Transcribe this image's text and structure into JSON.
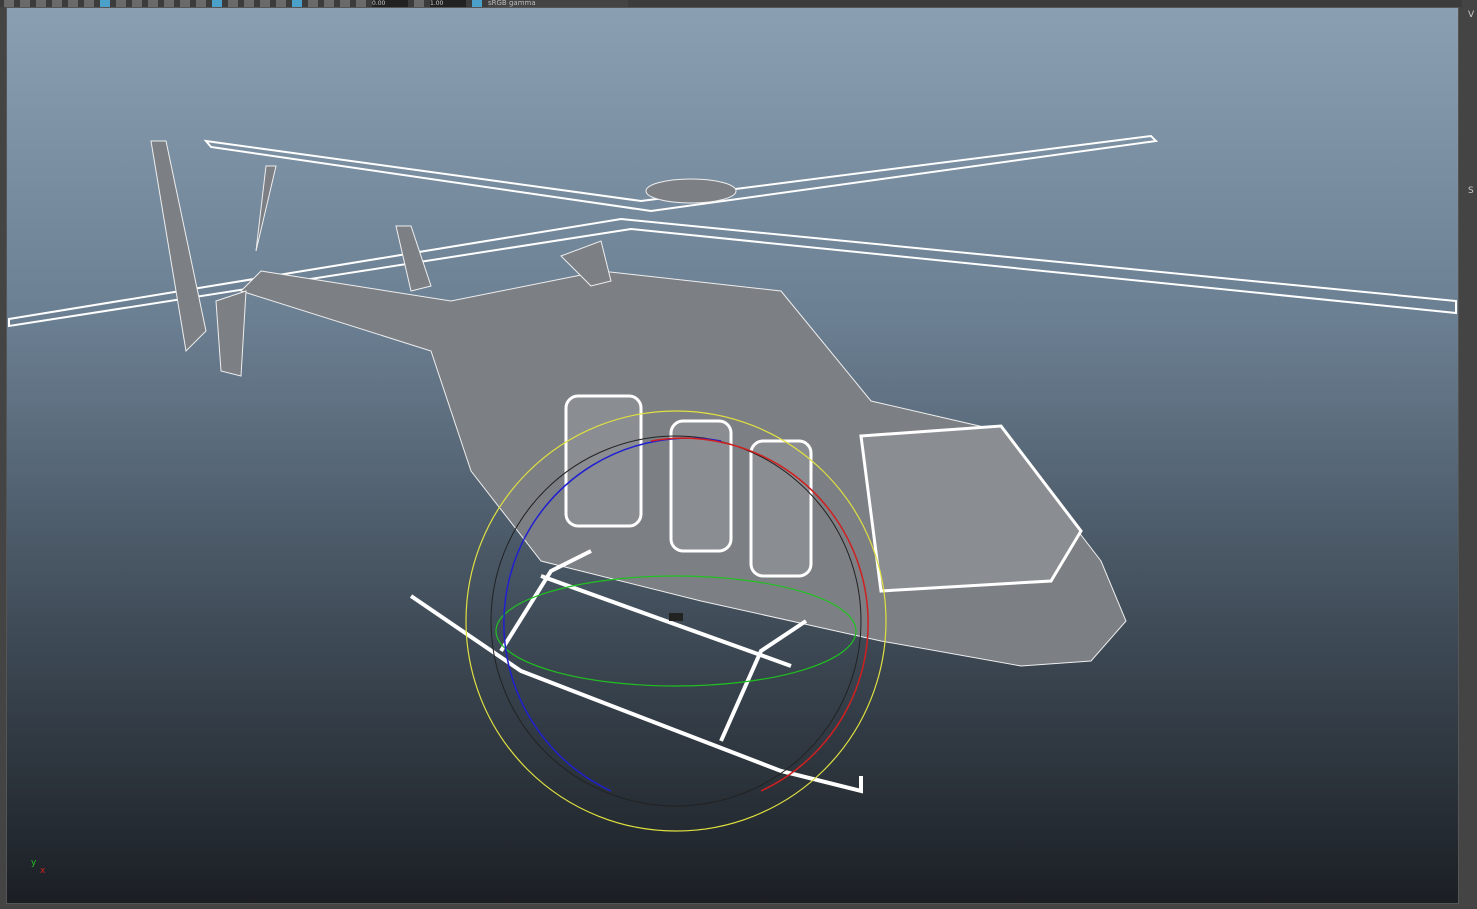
{
  "toolbar": {
    "exposure": "0.00",
    "gamma": "1.00",
    "color_space": "sRGB gamma",
    "accent": "#4aa0c8"
  },
  "viewport": {
    "axis_x": "x",
    "axis_y": "y",
    "manipulator_colors": {
      "x": "#d02020",
      "y": "#20c020",
      "z": "#2020d0",
      "view": "#e0e040"
    }
  },
  "side_panel": {
    "label_1": "V",
    "label_2": "S"
  }
}
